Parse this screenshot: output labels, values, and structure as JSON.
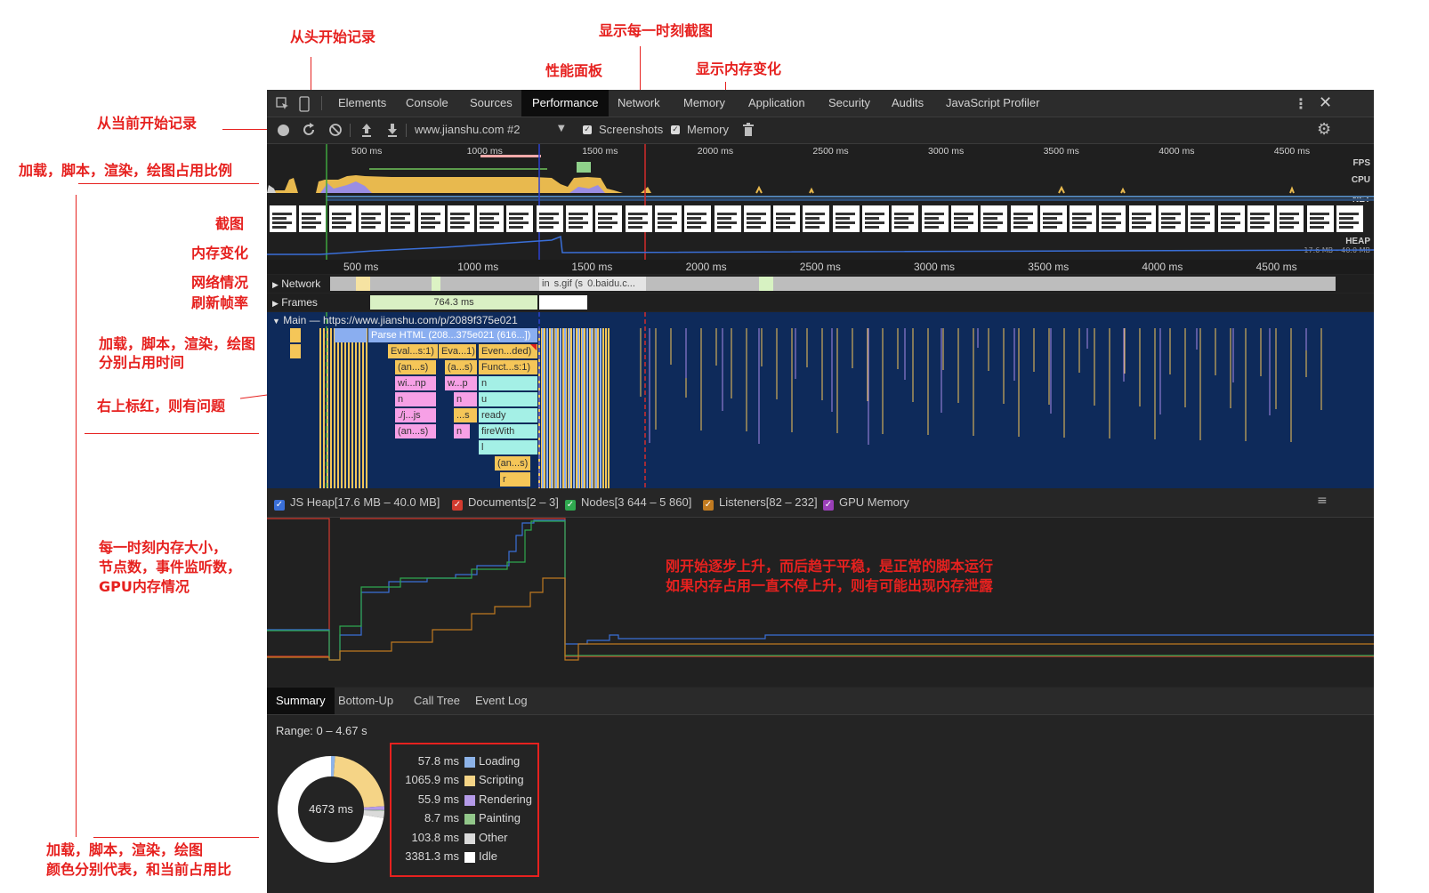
{
  "annotations": {
    "record_from_start": "从头开始记录",
    "screenshot_each_moment": "显示每一时刻截图",
    "perf_panel": "性能面板",
    "show_memory_change": "显示内存变化",
    "record_from_now": "从当前开始记录",
    "ratio": "加载，脚本，渲染，绘图占用比例",
    "screenshots": "截图",
    "memory_change": "内存变化",
    "network_status": "网络情况",
    "fps": "刷新帧率",
    "time_each_line1": "加载，脚本，渲染，绘图",
    "time_each_line2": "分别占用时间",
    "red_corner": "右上标红，则有问题",
    "mem_each_line1": "每一时刻内存大小，",
    "mem_each_line2": "节点数，事件监听数，",
    "mem_each_line3": "GPU内存情况",
    "colors_line1": "加载，脚本，渲染，绘图",
    "colors_line2": "颜色分别代表，和当前占用比",
    "mem_note_line1": "刚开始逐步上升，而后趋于平稳，是正常的脚本运行",
    "mem_note_line2": "如果内存占用一直不停上升，则有可能出现内存泄露"
  },
  "tabs": [
    "Elements",
    "Console",
    "Sources",
    "Performance",
    "Network",
    "Memory",
    "Application",
    "Security",
    "Audits",
    "JavaScript Profiler"
  ],
  "toolbar": {
    "profile_select": "www.jianshu.com #2",
    "screenshots_label": "Screenshots",
    "memory_label": "Memory"
  },
  "overview": {
    "ticks": [
      "500 ms",
      "1000 ms",
      "1500 ms",
      "2000 ms",
      "2500 ms",
      "3000 ms",
      "3500 ms",
      "4000 ms",
      "4500 ms"
    ],
    "fps_label": "FPS",
    "cpu_label": "CPU",
    "net_label": "NET",
    "heap_label": "HEAP",
    "heap_range": "17.6 MB – 40.0 MB"
  },
  "timeline": {
    "ticks": [
      "500 ms",
      "1000 ms",
      "1500 ms",
      "2000 ms",
      "2500 ms",
      "3000 ms",
      "3500 ms",
      "4000 ms",
      "4500 ms"
    ],
    "network_label": "Network",
    "network_req1": "in",
    "network_req2": "s.gif (s",
    "network_req3": "0.baidu.c...",
    "frames_label": "Frames",
    "frame_time": "764.3 ms",
    "main_label": "Main — https://www.jianshu.com/p/2089f375e021",
    "flame": [
      "Parse HTML (208...375e021 (616...])",
      "Eval...s:1)",
      "Eva...1)",
      "Even...ded)",
      "(an...s)",
      "(a...s)",
      "Funct...s:1)",
      "wi...np",
      "w...p",
      "n",
      "n",
      "n",
      "u",
      "n",
      "./j...js",
      "...s",
      "ready",
      "(an...s)",
      "n",
      "fireWith",
      "l",
      "(an...s)",
      "r"
    ]
  },
  "memory": {
    "legend": [
      {
        "label": "JS Heap[17.6 MB – 40.0 MB]",
        "color": "#3a6fd8"
      },
      {
        "label": "Documents[2 – 3]",
        "color": "#d33b2f"
      },
      {
        "label": "Nodes[3 644 – 5 860]",
        "color": "#2fa84f"
      },
      {
        "label": "Listeners[82 – 232]",
        "color": "#c07a20"
      },
      {
        "label": "GPU Memory",
        "color": "#9a3fb8"
      }
    ]
  },
  "summary": {
    "tabs": [
      "Summary",
      "Bottom-Up",
      "Call Tree",
      "Event Log"
    ],
    "range": "Range: 0 – 4.67 s",
    "total": "4673 ms",
    "rows": [
      {
        "value": "57.8 ms",
        "name": "Loading",
        "color": "#8db3e8"
      },
      {
        "value": "1065.9 ms",
        "name": "Scripting",
        "color": "#f5d486"
      },
      {
        "value": "55.9 ms",
        "name": "Rendering",
        "color": "#b49ae8"
      },
      {
        "value": "8.7 ms",
        "name": "Painting",
        "color": "#92c78a"
      },
      {
        "value": "103.8 ms",
        "name": "Other",
        "color": "#dadada"
      },
      {
        "value": "3381.3 ms",
        "name": "Idle",
        "color": "#ffffff"
      }
    ]
  },
  "chart_data": {
    "type": "pie",
    "categories": [
      "Loading",
      "Scripting",
      "Rendering",
      "Painting",
      "Other",
      "Idle"
    ],
    "values": [
      57.8,
      1065.9,
      55.9,
      8.7,
      103.8,
      3381.3
    ],
    "title": "4673 ms"
  }
}
